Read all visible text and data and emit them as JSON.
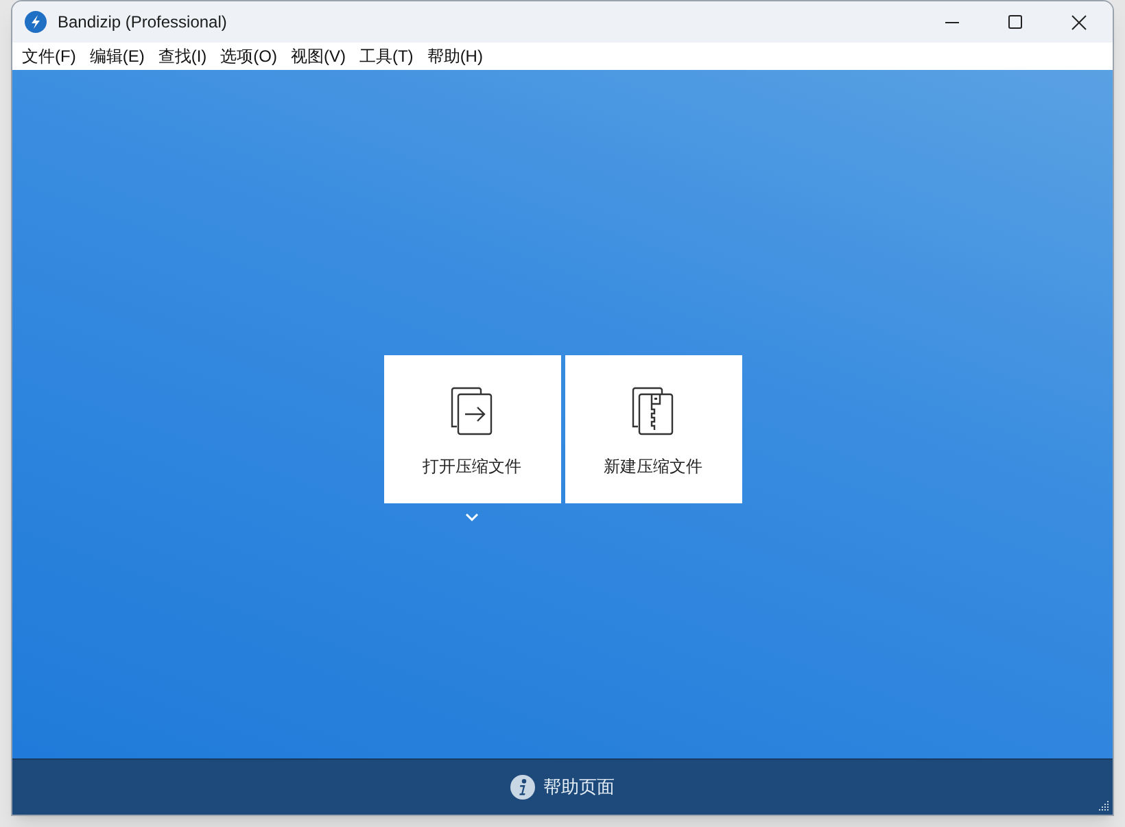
{
  "window": {
    "title": "Bandizip (Professional)"
  },
  "menu": [
    "文件(F)",
    "编辑(E)",
    "查找(I)",
    "选项(O)",
    "视图(V)",
    "工具(T)",
    "帮助(H)"
  ],
  "actions": [
    {
      "kind": "open",
      "label": "打开压缩文件",
      "dropdown": true
    },
    {
      "kind": "new",
      "label": "新建压缩文件",
      "dropdown": false
    }
  ],
  "footer": {
    "label": "帮助页面"
  }
}
